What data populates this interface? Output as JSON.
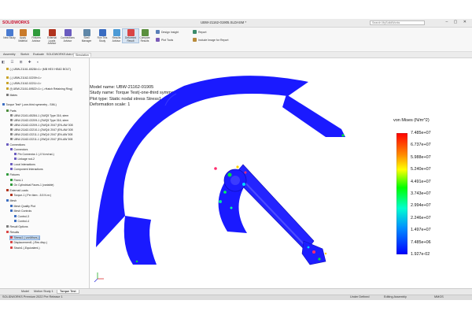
{
  "app": {
    "logo": "SOLIDWORKS",
    "title": "UBW-21162-01905.SLDASM *",
    "search_placeholder": "Search MySolidWorks",
    "window_controls": "– ▢ ✕"
  },
  "ribbon": {
    "buttons": [
      {
        "label": "New Study",
        "icon": "new-study-icon",
        "color": "#4a7bd0"
      },
      {
        "label": "Apply Material",
        "icon": "material-icon",
        "color": "#c97a2a"
      },
      {
        "label": "Fixtures Advisor",
        "icon": "fixtures-icon",
        "color": "#2f9a3b"
      },
      {
        "label": "External Loads Advisor",
        "icon": "loads-icon",
        "color": "#b0331e"
      },
      {
        "label": "Connections Advisor",
        "icon": "connections-icon",
        "color": "#6a5bbf"
      },
      {
        "label": "Shell Manager",
        "icon": "shell-icon",
        "color": "#5f87a8"
      },
      {
        "label": "Run This Study",
        "icon": "run-icon",
        "color": "#3a6cc1"
      },
      {
        "label": "Results Advisor",
        "icon": "results-icon",
        "color": "#4d9bd6"
      },
      {
        "label": "Deformed Result",
        "icon": "deformed-icon",
        "color": "#d94545",
        "active": true
      },
      {
        "label": "Compare Results",
        "icon": "compare-icon",
        "color": "#5a8f3d"
      }
    ],
    "design_insight": "Design Insight",
    "plot_tools": "Plot Tools",
    "report": "Report",
    "include_image": "Include Image for Report"
  },
  "cm_tabs": [
    "Assembly",
    "Sketch",
    "Evaluate",
    "SOLIDWORKS Add-Ins",
    "Simulation"
  ],
  "cm_active": "Simulation",
  "tree": {
    "rows": [
      {
        "label": "(-) UBW-21161-65284<1> (MB HEX HEAD BOLT)",
        "indent": 1,
        "color": "#c9a227"
      },
      {
        "label": "(-) UBW-21162-02209<1>",
        "indent": 1,
        "color": "#c9a227"
      },
      {
        "label": "(-) UBW-21162-02211<1>",
        "indent": 1,
        "color": "#c9a227"
      },
      {
        "label": "(f) UBW-21161-69522<1> (->Hatch Retaining Ring)",
        "indent": 1,
        "color": "#c9a227"
      },
      {
        "label": "Mates",
        "indent": 1,
        "color": "#7a7a7a"
      },
      {
        "label": "Torque Test* (-one-third symmetry - SIM-)",
        "indent": 0,
        "color": "#3a6cc1"
      },
      {
        "label": "Parts",
        "indent": 1,
        "color": "#4a8b3b"
      },
      {
        "label": "UBW-21161-65284-1 (1WQ5 Type 316, stem",
        "indent": 2,
        "color": "#8b8b8b"
      },
      {
        "label": "UBW-21162-02209-1 (2WQ5 Type 316, stem",
        "indent": 2,
        "color": "#8b8b8b"
      },
      {
        "label": "UBW-21162-02209-1 (2WQ4/ 2047 (EN-AW 308",
        "indent": 2,
        "color": "#8b8b8b"
      },
      {
        "label": "UBW-21162-02210-1 (2WQ4/ 2047 (EN-AW 308",
        "indent": 2,
        "color": "#8b8b8b"
      },
      {
        "label": "UBW-21162-02211-1 (2WQ4/ 2047 (EN-AW 308",
        "indent": 2,
        "color": "#8b8b8b"
      },
      {
        "label": "UBW-21162-02211-1 (2WQ4/ 2047 (EN-AW 308",
        "indent": 2,
        "color": "#8b8b8b"
      },
      {
        "label": "Connections",
        "indent": 1,
        "color": "#6a5bbf"
      },
      {
        "label": "Connectors",
        "indent": 2,
        "color": "#6a5bbf"
      },
      {
        "label": "Pin Connector-1 (-0 N.m/rad-)",
        "indent": 3,
        "color": "#6a5bbf"
      },
      {
        "label": "Linkage rod-2",
        "indent": 3,
        "color": "#6a5bbf"
      },
      {
        "label": "Local Interactions",
        "indent": 2,
        "color": "#6a5bbf"
      },
      {
        "label": "Component Interactions",
        "indent": 2,
        "color": "#6a5bbf"
      },
      {
        "label": "Fixtures",
        "indent": 1,
        "color": "#2f9a3b"
      },
      {
        "label": "Fixed-1",
        "indent": 2,
        "color": "#2f9a3b"
      },
      {
        "label": "On Cylindrical Faces-1 (variable)",
        "indent": 2,
        "color": "#2f9a3b"
      },
      {
        "label": "External Loads",
        "indent": 1,
        "color": "#b0331e"
      },
      {
        "label": "Torque-1 (:Per item: -5.5 N.m:)",
        "indent": 2,
        "color": "#b0331e"
      },
      {
        "label": "Mesh",
        "indent": 1,
        "color": "#3a6cc1"
      },
      {
        "label": "Mesh Quality Plot",
        "indent": 2,
        "color": "#3a6cc1"
      },
      {
        "label": "Mesh Controls",
        "indent": 2,
        "color": "#3a6cc1"
      },
      {
        "label": "Control-3",
        "indent": 3,
        "color": "#3a6cc1"
      },
      {
        "label": "Control-4",
        "indent": 3,
        "color": "#3a6cc1"
      },
      {
        "label": "Result Options",
        "indent": 1,
        "color": "#7a7a7a"
      },
      {
        "label": "Results",
        "indent": 1,
        "color": "#d94545"
      },
      {
        "label": "Stress1 (-vonMises-)",
        "indent": 2,
        "color": "#d94545",
        "selected": true
      },
      {
        "label": "Displacement1 (-Res disp-)",
        "indent": 2,
        "color": "#d94545"
      },
      {
        "label": "Strain1 (-Equivalent-)",
        "indent": 2,
        "color": "#d94545"
      }
    ]
  },
  "viewport": {
    "info": {
      "model_name": "Model name: UBW-21162-01905",
      "study_name": "Study name: Torque Test(-one-third symmetry - SIM-)",
      "plot_type": "Plot type: Static nodal stress Stress1",
      "deformation": "Deformation scale: 1"
    },
    "legend": {
      "title": "von Mises (N/m^2)",
      "labels": [
        "7.485e+07",
        "6.737e+07",
        "5.988e+07",
        "5.240e+07",
        "4.491e+07",
        "3.743e+07",
        "2.994e+07",
        "2.246e+07",
        "1.497e+07",
        "7.485e+06",
        "1.927e-02"
      ]
    },
    "model_color": "#1a1aff"
  },
  "bottom_tabs": [
    "Model",
    "Motion Study 1",
    "Torque Test"
  ],
  "bottom_active": "Torque Test",
  "status": {
    "left": "SOLIDWORKS Premium 2022 Pre Release 1",
    "mid": "Under Defined",
    "editing": "Editing Assembly",
    "units": "MMGS"
  }
}
